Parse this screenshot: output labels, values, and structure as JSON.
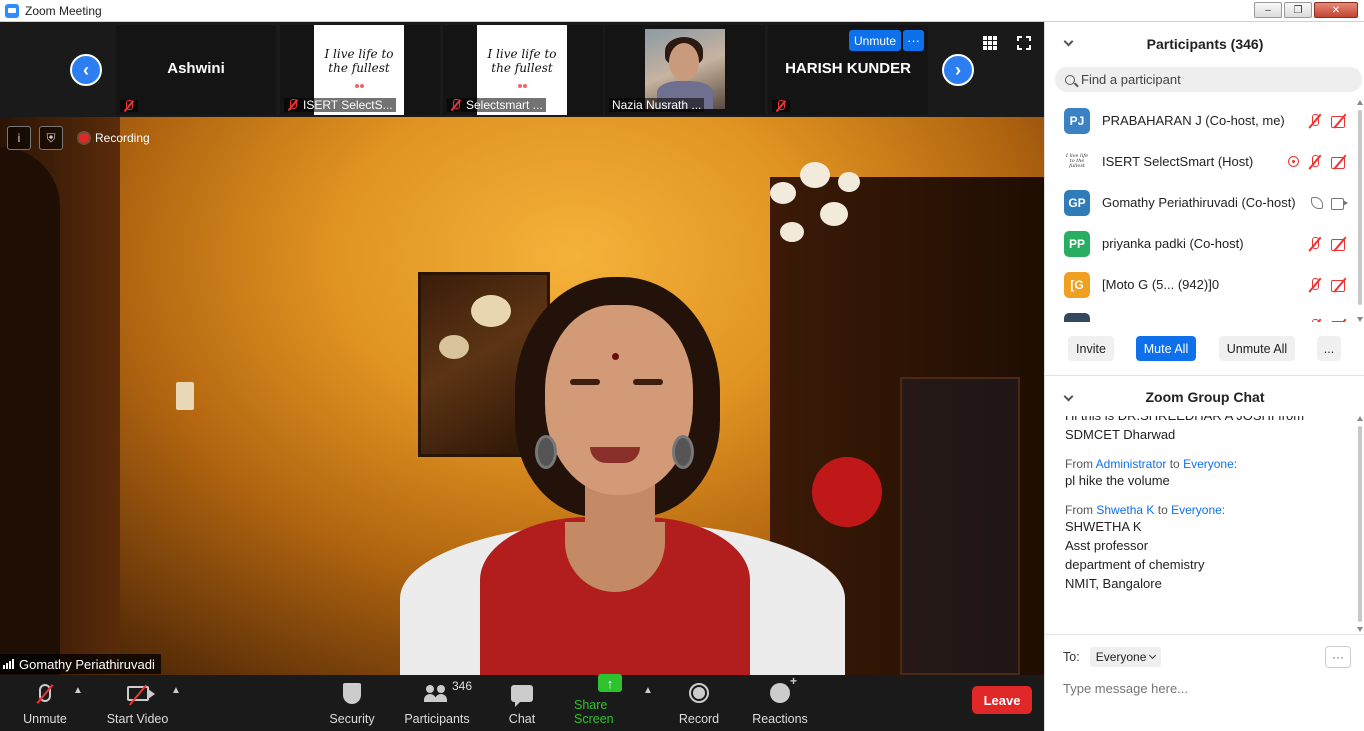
{
  "window": {
    "title": "Zoom Meeting",
    "controls": [
      "–",
      "❐",
      "✕"
    ]
  },
  "strip": {
    "tiles": [
      {
        "name": "Ashwini",
        "label": ""
      },
      {
        "name": "",
        "label": "ISERT SelectS...",
        "thumb_text": "I live life to the fullest"
      },
      {
        "name": "",
        "label": "Selectsmart ...",
        "thumb_text": "I live life to the fullest"
      },
      {
        "name": "",
        "label": "Nazia Nusrath ..."
      },
      {
        "name": "HARISH KUNDER",
        "label": ""
      }
    ],
    "unmute_label": "Unmute",
    "more_label": "···"
  },
  "video": {
    "recording_label": "Recording",
    "speaker_name": "Gomathy Periathiruvadi"
  },
  "toolbar": {
    "unmute": "Unmute",
    "start_video": "Start Video",
    "security": "Security",
    "participants": "Participants",
    "participants_count": "346",
    "chat": "Chat",
    "share_screen": "Share Screen",
    "record": "Record",
    "reactions": "Reactions",
    "leave": "Leave",
    "share_arrow": "↑"
  },
  "participants": {
    "title": "Participants (346)",
    "search_placeholder": "Find a participant",
    "list": [
      {
        "initials": "PJ",
        "color": "#3b82c4",
        "name": "PRABAHARAN J (Co-host, me)",
        "icons": [
          "mic-off",
          "cam-off"
        ]
      },
      {
        "initials": "",
        "thumb_text": "I live life to the fullest",
        "name": "ISERT SelectSmart (Host)",
        "icons": [
          "recording",
          "mic-off",
          "cam-off"
        ]
      },
      {
        "initials": "GP",
        "color": "#2f7cb8",
        "name": "Gomathy Periathiruvadi (Co-host)",
        "icons": [
          "phone",
          "cam"
        ]
      },
      {
        "initials": "PP",
        "color": "#27ae60",
        "name": "priyanka padki (Co-host)",
        "icons": [
          "mic-off",
          "cam-off"
        ]
      },
      {
        "initials": "[G",
        "color": "#f0a020",
        "name": "[Moto G (5... (942)]0",
        "icons": [
          "mic-off",
          "cam-off"
        ]
      }
    ],
    "actions": {
      "invite": "Invite",
      "mute_all": "Mute All",
      "unmute_all": "Unmute All",
      "more": "..."
    }
  },
  "chat": {
    "title": "Zoom Group Chat",
    "messages": [
      {
        "from_prefix": "",
        "from": "",
        "to_word": "",
        "to": "",
        "lines": [
          "Hi this is DR.SHREEDHAR A JOSHI from",
          "SDMCET Dharwad"
        ]
      },
      {
        "from_prefix": "From",
        "from": "Administrator",
        "to_word": "to",
        "to": "Everyone:",
        "lines": [
          "pl hike the volume"
        ]
      },
      {
        "from_prefix": "From",
        "from": "Shwetha K",
        "to_word": "to",
        "to": "Everyone:",
        "lines": [
          "SHWETHA K",
          "Asst professor",
          "department of chemistry",
          "NMIT, Bangalore"
        ]
      }
    ],
    "to_label": "To:",
    "to_value": "Everyone",
    "more_label": "···",
    "input_placeholder": "Type message here..."
  }
}
